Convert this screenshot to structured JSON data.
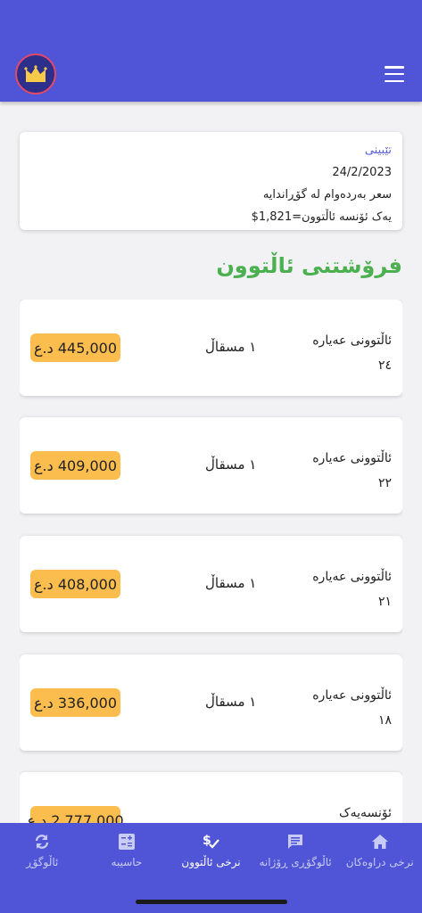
{
  "header": {
    "logo_icon": "crown-icon",
    "menu_icon": "hamburger-menu-icon"
  },
  "note": {
    "title": "تێبینی",
    "date": "24/2/2023",
    "line1": "سعر بەردەوام لە گۆڕاندایە",
    "line2": "یەک ئۆنسە ئاڵتوون=1,821$"
  },
  "section_title": "فرۆشتنی ئاڵتوون",
  "items": [
    {
      "name": "ئاڵتوونی عەیارە",
      "karat": "٢٤",
      "unit": "١ مسقاڵ",
      "price": "445,000 د.ع"
    },
    {
      "name": "ئاڵتوونی عەیارە",
      "karat": "٢٢",
      "unit": "١ مسقاڵ",
      "price": "409,000 د.ع"
    },
    {
      "name": "ئاڵتوونی عەیارە",
      "karat": "٢١",
      "unit": "١ مسقاڵ",
      "price": "408,000 د.ع"
    },
    {
      "name": "ئاڵتوونی عەیارە",
      "karat": "١٨",
      "unit": "١ مسقاڵ",
      "price": "336,000 د.ع"
    },
    {
      "name": "ئۆنسەیەک",
      "karat": "",
      "unit": "",
      "price": "2,777,000 د.ع"
    }
  ],
  "nav": [
    {
      "label": "نرخی دراوەکان",
      "icon": "home-icon",
      "active": false
    },
    {
      "label": "ئاڵوگۆڕی ڕۆژانە",
      "icon": "message-icon",
      "active": false
    },
    {
      "label": "نرخی ئاڵتوون",
      "icon": "dollar-check-icon",
      "active": true
    },
    {
      "label": "حاسیبە",
      "icon": "calculator-icon",
      "active": false
    },
    {
      "label": "ئاڵوگۆڕ",
      "icon": "exchange-icon",
      "active": false
    }
  ],
  "colors": {
    "primary": "#4f55d6",
    "accent_green": "#4caf50",
    "price_badge": "#fbbd4e"
  }
}
